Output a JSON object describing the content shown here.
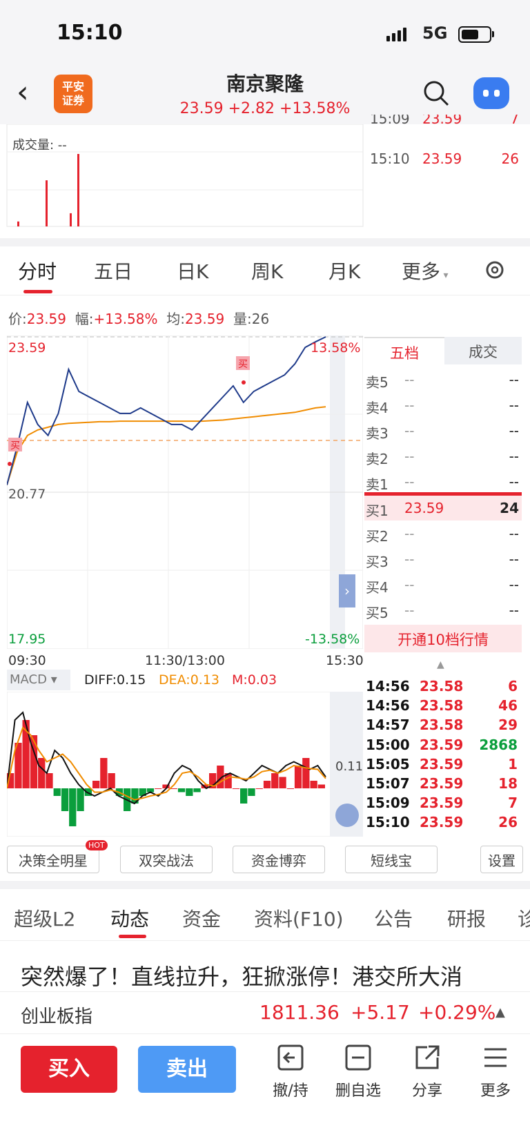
{
  "status": {
    "time": "15:10",
    "network": "5G"
  },
  "header": {
    "logo_line1": "平安",
    "logo_line2": "证券",
    "title": "南京聚隆",
    "quote": "23.59 +2.82 +13.58%"
  },
  "volume_panel": {
    "label": "成交量: --",
    "latest_trades": [
      {
        "time": "15:09",
        "price": "23.59",
        "vol": "7"
      },
      {
        "time": "15:10",
        "price": "23.59",
        "vol": "26"
      }
    ],
    "bars": [
      3,
      28,
      8,
      44
    ]
  },
  "tabs": [
    "分时",
    "五日",
    "日K",
    "周K",
    "月K",
    "更多"
  ],
  "info": {
    "price_label": "价:",
    "price": "23.59",
    "change_label": "幅:",
    "change": "+13.58%",
    "avg_label": "均:",
    "avg": "23.59",
    "vol_label": "量:",
    "vol": "26"
  },
  "chart_data": {
    "type": "line",
    "y_top": "23.59",
    "y_mid": "20.77",
    "y_bottom": "17.95",
    "pct_top": "13.58%",
    "pct_bottom": "-13.58%",
    "x_labels": [
      "09:30",
      "11:30/13:00",
      "15:30"
    ],
    "ylim": [
      17.95,
      23.59
    ],
    "series": [
      {
        "values": [
          20.9,
          21.6,
          22.4,
          22.0,
          21.8,
          22.2,
          23.0,
          22.6,
          22.5,
          22.4,
          22.3,
          22.2,
          22.2,
          22.3,
          22.2,
          22.1,
          22.0,
          22.0,
          21.9,
          22.1,
          22.3,
          22.5,
          22.7,
          22.4,
          22.6,
          22.7,
          22.8,
          22.9,
          23.1,
          23.4,
          23.5,
          23.59
        ]
      },
      {
        "values": [
          20.9,
          21.5,
          21.8,
          21.9,
          21.95,
          22.0,
          22.02,
          22.03,
          22.04,
          22.05,
          22.05,
          22.06,
          22.06,
          22.06,
          22.06,
          22.06,
          22.06,
          22.06,
          22.06,
          22.06,
          22.07,
          22.08,
          22.1,
          22.12,
          22.14,
          22.16,
          22.18,
          22.2,
          22.22,
          22.26,
          22.3,
          22.32
        ]
      }
    ],
    "markers": [
      "买",
      "买"
    ]
  },
  "macd": {
    "label": "MACD",
    "diff": "DIFF:0.15",
    "dea": "DEA:0.13",
    "m": "M:0.03",
    "axis_value": "0.11",
    "histogram": [
      0.2,
      0.6,
      0.9,
      0.7,
      0.4,
      0.2,
      -0.1,
      -0.3,
      -0.5,
      -0.3,
      -0.1,
      0.1,
      0.4,
      0.2,
      -0.1,
      -0.3,
      -0.2,
      -0.1,
      -0.05,
      0.0,
      0.05,
      0.0,
      -0.05,
      -0.1,
      -0.05,
      0.05,
      0.2,
      0.3,
      0.2,
      0.0,
      -0.2,
      -0.1,
      0.0,
      0.1,
      0.2,
      0.15,
      0.0,
      0.3,
      0.4,
      0.1,
      0.05
    ],
    "diff_line": [
      0.0,
      0.9,
      1.0,
      0.6,
      0.3,
      0.2,
      0.5,
      0.4,
      0.2,
      0.05,
      -0.05,
      -0.1,
      -0.05,
      0.0,
      -0.1,
      -0.15,
      -0.2,
      -0.1,
      -0.05,
      -0.1,
      0.0,
      0.2,
      0.3,
      0.25,
      0.1,
      0.0,
      0.05,
      0.15,
      0.2,
      0.15,
      0.1,
      0.2,
      0.3,
      0.25,
      0.2,
      0.3,
      0.35,
      0.3,
      0.25,
      0.3,
      0.15
    ],
    "dea_line": [
      0.0,
      0.5,
      0.8,
      0.7,
      0.5,
      0.35,
      0.4,
      0.45,
      0.35,
      0.2,
      0.05,
      -0.05,
      -0.05,
      -0.02,
      -0.05,
      -0.1,
      -0.15,
      -0.13,
      -0.1,
      -0.08,
      -0.05,
      0.05,
      0.2,
      0.22,
      0.15,
      0.05,
      0.03,
      0.1,
      0.15,
      0.14,
      0.12,
      0.15,
      0.22,
      0.24,
      0.2,
      0.24,
      0.3,
      0.28,
      0.26,
      0.25,
      0.13
    ]
  },
  "order_book": {
    "tab_wudang": "五档",
    "tab_chengjiao": "成交",
    "asks": [
      {
        "label": "卖5",
        "price": "--",
        "vol": "--"
      },
      {
        "label": "卖4",
        "price": "--",
        "vol": "--"
      },
      {
        "label": "卖3",
        "price": "--",
        "vol": "--"
      },
      {
        "label": "卖2",
        "price": "--",
        "vol": "--"
      },
      {
        "label": "卖1",
        "price": "--",
        "vol": "--"
      }
    ],
    "bids": [
      {
        "label": "买1",
        "price": "23.59",
        "vol": "24"
      },
      {
        "label": "买2",
        "price": "--",
        "vol": "--"
      },
      {
        "label": "买3",
        "price": "--",
        "vol": "--"
      },
      {
        "label": "买4",
        "price": "--",
        "vol": "--"
      },
      {
        "label": "买5",
        "price": "--",
        "vol": "--"
      }
    ],
    "open_l10": "开通10档行情"
  },
  "tick_list": [
    {
      "time": "14:56",
      "price": "23.58",
      "vol": "6"
    },
    {
      "time": "14:56",
      "price": "23.58",
      "vol": "46"
    },
    {
      "time": "14:57",
      "price": "23.58",
      "vol": "29"
    },
    {
      "time": "15:00",
      "price": "23.59",
      "vol": "2868"
    },
    {
      "time": "15:05",
      "price": "23.59",
      "vol": "1"
    },
    {
      "time": "15:07",
      "price": "23.59",
      "vol": "18"
    },
    {
      "time": "15:09",
      "price": "23.59",
      "vol": "7"
    },
    {
      "time": "15:10",
      "price": "23.59",
      "vol": "26"
    }
  ],
  "tools": {
    "b1": "决策全明星",
    "hot": "HOT",
    "b2": "双突战法",
    "b3": "资金博弈",
    "b4": "短线宝",
    "settings": "设置"
  },
  "feature_tabs": [
    "超级L2",
    "动态",
    "资金",
    "资料(F10)",
    "公告",
    "研报",
    "诊"
  ],
  "news_headline": "突然爆了！直线拉升，狂掀涨停！港交所大消",
  "index_ticker": {
    "name": "创业板指",
    "value": "1811.36",
    "change": "+5.17",
    "pct": "+0.29%"
  },
  "actions": {
    "buy": "买入",
    "sell": "卖出",
    "cancel": "撤/持",
    "remove": "删自选",
    "share": "分享",
    "more": "更多"
  },
  "colors": {
    "red": "#e5222d",
    "green": "#0a9e3c",
    "blue": "#1e3a8a",
    "orange": "#f08c00",
    "sell_blue": "#4e9af5"
  }
}
